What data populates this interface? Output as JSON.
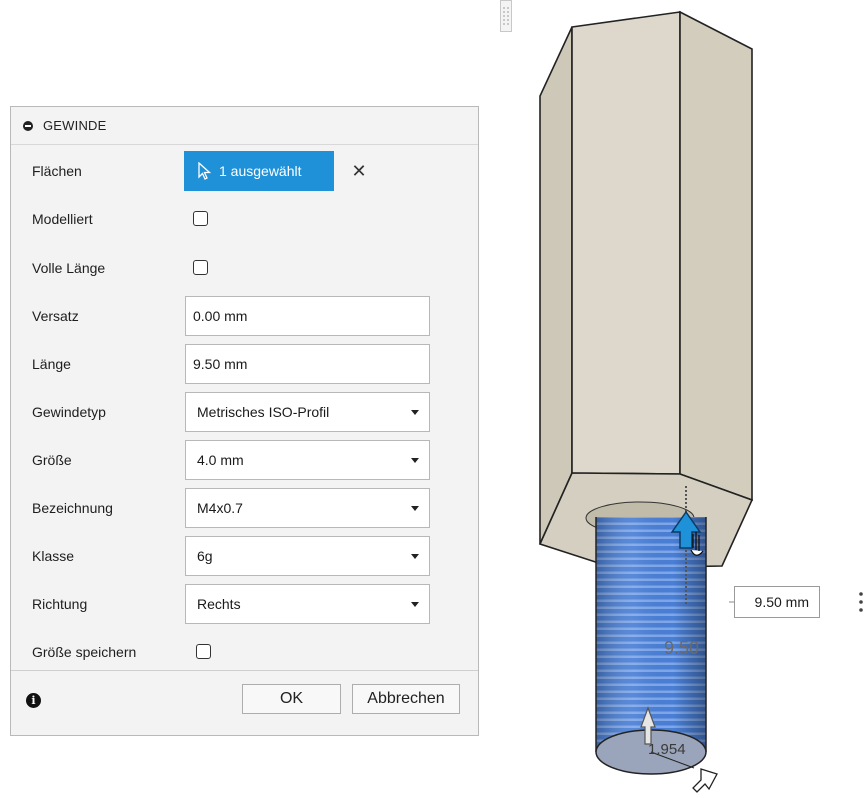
{
  "dialog": {
    "title": "GEWINDE",
    "faces": {
      "label": "Flächen",
      "button": "1 ausgewählt",
      "clear_icon": "close-icon",
      "clear_glyph": "✕"
    },
    "modeled": {
      "label": "Modelliert",
      "checked": false
    },
    "full_length": {
      "label": "Volle Länge",
      "checked": false
    },
    "offset": {
      "label": "Versatz",
      "value": "0.00 mm"
    },
    "length": {
      "label": "Länge",
      "value": "9.50 mm"
    },
    "thread_type": {
      "label": "Gewindetyp",
      "value": "Metrisches ISO-Profil"
    },
    "size": {
      "label": "Größe",
      "value": "4.0 mm"
    },
    "designation": {
      "label": "Bezeichnung",
      "value": "M4x0.7"
    },
    "class": {
      "label": "Klasse",
      "value": "6g"
    },
    "direction": {
      "label": "Richtung",
      "value": "Rechts"
    },
    "save_size": {
      "label": "Größe speichern",
      "checked": false
    },
    "info_glyph": "i",
    "ok_label": "OK",
    "cancel_label": "Abbrechen"
  },
  "viewport": {
    "distance_input": "9.50 mm",
    "length_annotation": "9.50",
    "diameter_annotation": "1.954"
  },
  "colors": {
    "accent": "#1f91d8",
    "thread_blue": "#4a7fd6",
    "hex_body": "#d9d4c6",
    "hex_side": "#cbc5b5"
  }
}
